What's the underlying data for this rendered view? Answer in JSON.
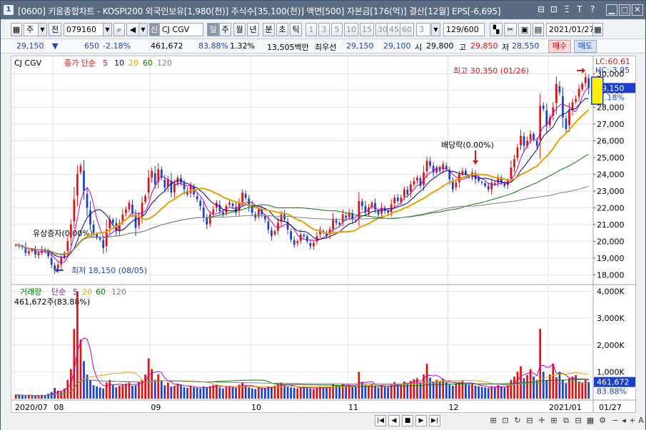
{
  "window": {
    "app_icon": "1",
    "title": "[0600] 키움종합차트 - KOSPI200 외국인보유[1,980(천)] 주식수[35,100(천)] 액면[500] 자본금[176(억)] 결산[12월] EPS[-6,695]",
    "title_icons": [
      "window-icon",
      "pin-icon",
      "text-icon",
      "font-t-icon",
      "help-icon"
    ],
    "title_icon_glyphs": [
      "⊟",
      "⊡",
      "Ξ",
      "T",
      "?"
    ],
    "controls": {
      "minimize": "▁",
      "maximize": "□",
      "close": "✕"
    }
  },
  "toolbar": {
    "market_type": "주",
    "prev_label": "전",
    "stock_code": "079160",
    "stock_name": "CJ CGV",
    "stock_prefix": "신",
    "periods": [
      "일",
      "주",
      "월",
      "년",
      "분",
      "초",
      "틱"
    ],
    "active_period": "일",
    "interval_buttons": [
      "1",
      "3",
      "5",
      "10",
      "15",
      "30",
      "45",
      "60"
    ],
    "interval_value": "3",
    "count": "129/600",
    "date": "2021/01/27"
  },
  "info": {
    "price": "29,150",
    "price_arrow": "▼",
    "change": "650",
    "change_pct": "-2.18%",
    "volume": "461,672",
    "volume_ratio": "83.88%",
    "turnover": "1.32%",
    "amount": "13,505백만",
    "best_ask_label": "최우선",
    "best_ask": "29,150",
    "best_bid": "29,100",
    "open_label": "시",
    "open": "29,800",
    "high_label": "고",
    "high": "29,850",
    "low_label": "저",
    "low": "28,550",
    "buy_label": "매수",
    "sell_label": "매도"
  },
  "colors": {
    "up": "#e01010",
    "down": "#1a3fcc",
    "ma5": "#c000c0",
    "ma10": "#00008b",
    "ma20": "#e8a000",
    "ma60": "#008000",
    "ma120": "#808080"
  },
  "chart_data": {
    "type": "candlestick",
    "price_legend": {
      "name": "CJ CGV",
      "ma_label": "종가 단순",
      "periods": [
        "5",
        "10",
        "20",
        "60",
        "120"
      ]
    },
    "volume_legend": {
      "name": "거래량",
      "ma_label": "단순",
      "periods": [
        "5",
        "20",
        "60",
        "120"
      ],
      "current": "461,672주(83.88%)"
    },
    "lc_label": "LC:60.61",
    "hc_label": "HC:-3.95",
    "price_axis": {
      "min": 17500,
      "max": 30700,
      "ticks": [
        18000,
        19000,
        20000,
        21000,
        22000,
        23000,
        24000,
        25000,
        26000,
        27000,
        28000,
        29000,
        30000
      ]
    },
    "price_tick_labels": [
      "18,000",
      "19,000",
      "20,000",
      "21,000",
      "22,000",
      "23,000",
      "24,000",
      "25,000",
      "26,000",
      "27,000",
      "28,000",
      "29,000",
      "30,000"
    ],
    "current_price_label": "29,150",
    "current_change_label": "-2.18%",
    "volume_axis": {
      "min": 0,
      "max": 4200,
      "ticks": [
        1000,
        2000,
        3000,
        4000
      ]
    },
    "volume_tick_labels": [
      "1,000K",
      "2,000K",
      "3,000K",
      "4,000K"
    ],
    "current_volume_label": "461,672",
    "current_volume_pct": "83.88%",
    "x_labels": [
      "2020/07",
      "08",
      "09",
      "10",
      "11",
      "12",
      "2021/01"
    ],
    "x_label_index": [
      0,
      12,
      42,
      73,
      103,
      134,
      165
    ],
    "last_date_label": "01/27",
    "annotations": {
      "high": "최고 30,350 (01/26)",
      "low": "최저 18,150 (08/05)",
      "rights": "유상증자(0.00%)",
      "dividend": "배당락(0.00%)"
    },
    "close": [
      19800,
      19700,
      19650,
      19300,
      19400,
      19500,
      19200,
      19300,
      19500,
      19400,
      19100,
      18600,
      18300,
      18600,
      19000,
      19300,
      20000,
      21000,
      22500,
      24000,
      24500,
      23000,
      22000,
      21000,
      20500,
      20200,
      20100,
      19600,
      20700,
      21300,
      21100,
      20600,
      21100,
      21600,
      21900,
      22300,
      21700,
      20800,
      21400,
      22300,
      22700,
      23800,
      24200,
      23400,
      24300,
      23800,
      23200,
      23700,
      22900,
      23400,
      23800,
      23500,
      23100,
      22800,
      23300,
      22800,
      22500,
      22100,
      21400,
      21000,
      21600,
      21900,
      22300,
      21800,
      21600,
      22100,
      22300,
      22100,
      21700,
      22300,
      22900,
      22600,
      22100,
      21700,
      21400,
      21900,
      21600,
      21300,
      20700,
      20300,
      20600,
      21100,
      21600,
      21300,
      20700,
      20100,
      19800,
      20000,
      20400,
      20300,
      20000,
      19700,
      19900,
      20300,
      20700,
      20500,
      20300,
      20700,
      21300,
      21100,
      21000,
      21600,
      21400,
      21700,
      21300,
      21200,
      22400,
      22100,
      21700,
      22000,
      22300,
      21900,
      21600,
      22000,
      21800,
      21700,
      22200,
      22600,
      22400,
      22600,
      23100,
      22800,
      23400,
      23600,
      23800,
      23300,
      24100,
      24800,
      24500,
      24100,
      24400,
      24200,
      24600,
      24300,
      23700,
      23100,
      23500,
      24000,
      24200,
      24000,
      23800,
      24100,
      23700,
      23600,
      23500,
      23300,
      23100,
      23500,
      23400,
      23800,
      23500,
      23300,
      23600,
      24400,
      24900,
      25600,
      26300,
      25700,
      26000,
      26400,
      26100,
      25700,
      28100,
      27900,
      26900,
      27400,
      28000,
      29400,
      28900,
      27400,
      26700,
      27800,
      28300,
      28500,
      29100,
      29400,
      29800,
      29150
    ],
    "volume": [
      150,
      120,
      110,
      100,
      130,
      120,
      100,
      110,
      140,
      120,
      180,
      250,
      400,
      300,
      260,
      380,
      700,
      1100,
      2600,
      4000,
      2200,
      1400,
      900,
      700,
      500,
      450,
      420,
      380,
      600,
      700,
      500,
      420,
      480,
      520,
      560,
      600,
      480,
      500,
      620,
      700,
      900,
      1500,
      1100,
      700,
      900,
      650,
      500,
      600,
      450,
      480,
      560,
      500,
      420,
      400,
      480,
      420,
      400,
      380,
      450,
      420,
      460,
      500,
      520,
      420,
      380,
      460,
      480,
      420,
      400,
      520,
      600,
      480,
      420,
      380,
      360,
      420,
      400,
      380,
      450,
      420,
      480,
      560,
      600,
      500,
      440,
      420,
      400,
      380,
      420,
      440,
      400,
      380,
      360,
      400,
      460,
      420,
      400,
      440,
      540,
      500,
      460,
      560,
      480,
      520,
      460,
      440,
      1000,
      620,
      520,
      500,
      560,
      480,
      420,
      460,
      440,
      420,
      540,
      620,
      520,
      540,
      640,
      560,
      660,
      720,
      760,
      620,
      900,
      1300,
      780,
      640,
      700,
      640,
      740,
      620,
      520,
      480,
      560,
      620,
      660,
      560,
      520,
      560,
      480,
      460,
      440,
      420,
      400,
      460,
      420,
      500,
      440,
      420,
      480,
      700,
      820,
      1000,
      1200,
      760,
      880,
      1100,
      820,
      700,
      2600,
      1000,
      700,
      900,
      1300,
      800,
      1000,
      700,
      560,
      760,
      820,
      880,
      640,
      600,
      700,
      620
    ]
  }
}
